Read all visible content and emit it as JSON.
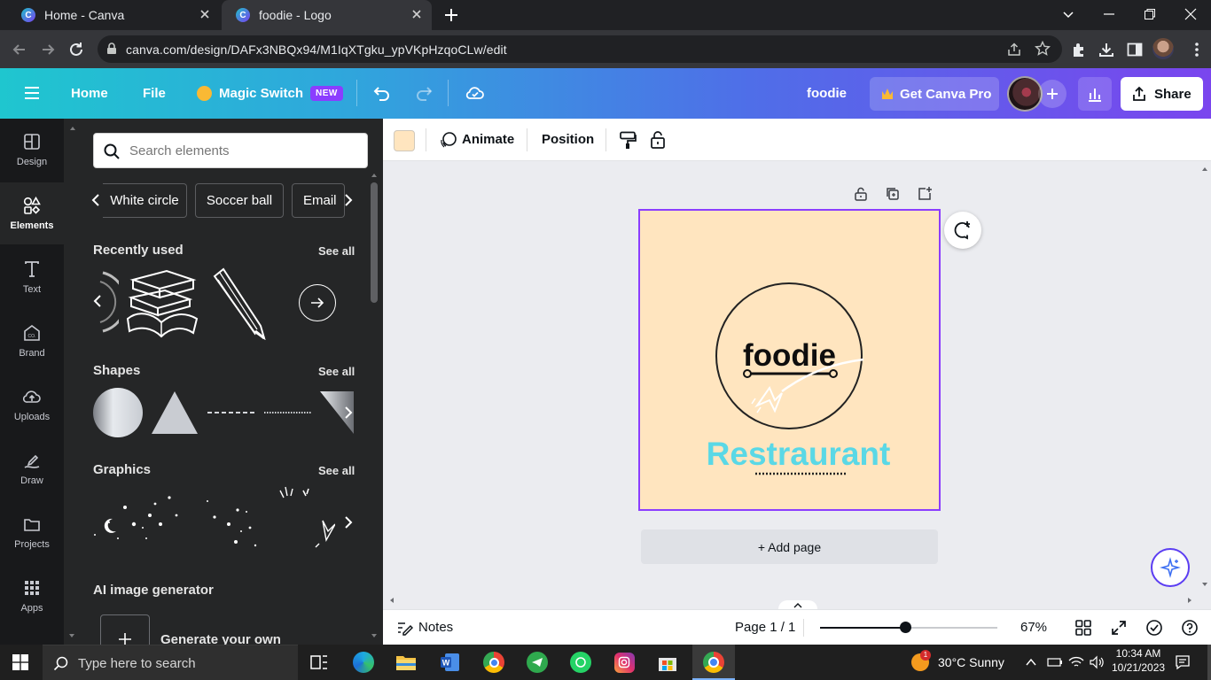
{
  "browser": {
    "tabs": [
      {
        "title": "Home - Canva",
        "active": false
      },
      {
        "title": "foodie - Logo",
        "active": true
      }
    ],
    "url": "canva.com/design/DAFx3NBQx94/M1IqXTgku_ypVKpHzqoCLw/edit"
  },
  "header": {
    "home": "Home",
    "file": "File",
    "magic_switch": "Magic Switch",
    "new_badge": "NEW",
    "doc_title": "foodie",
    "get_pro": "Get Canva Pro",
    "share": "Share"
  },
  "rail": {
    "items": [
      {
        "label": "Design",
        "icon": "design-icon"
      },
      {
        "label": "Elements",
        "icon": "elements-icon",
        "active": true
      },
      {
        "label": "Text",
        "icon": "text-icon"
      },
      {
        "label": "Brand",
        "icon": "brand-icon"
      },
      {
        "label": "Uploads",
        "icon": "uploads-icon"
      },
      {
        "label": "Draw",
        "icon": "draw-icon"
      },
      {
        "label": "Projects",
        "icon": "projects-icon"
      },
      {
        "label": "Apps",
        "icon": "apps-icon"
      }
    ]
  },
  "panel": {
    "search_placeholder": "Search elements",
    "chips": [
      "White circle",
      "Soccer ball",
      "Email"
    ],
    "sections": {
      "recent": "Recently used",
      "shapes": "Shapes",
      "graphics": "Graphics",
      "ai": "AI image generator"
    },
    "see_all": "See all",
    "generate": "Generate your own"
  },
  "toolbar": {
    "fill_color": "#ffe5bf",
    "animate": "Animate",
    "position": "Position"
  },
  "design": {
    "logo_word": "foodie",
    "subtitle": "Restraurant",
    "bg_color": "#ffe5bf",
    "subtitle_color": "#5ad8e6"
  },
  "canvas": {
    "add_page": "+ Add page"
  },
  "footer": {
    "notes": "Notes",
    "page": "Page 1 / 1",
    "zoom": "67%",
    "zoom_level": 0.48
  },
  "taskbar": {
    "search_placeholder": "Type here to search",
    "weather": "30°C  Sunny",
    "time": "10:34 AM",
    "date": "10/21/2023",
    "weather_alert": "1"
  }
}
